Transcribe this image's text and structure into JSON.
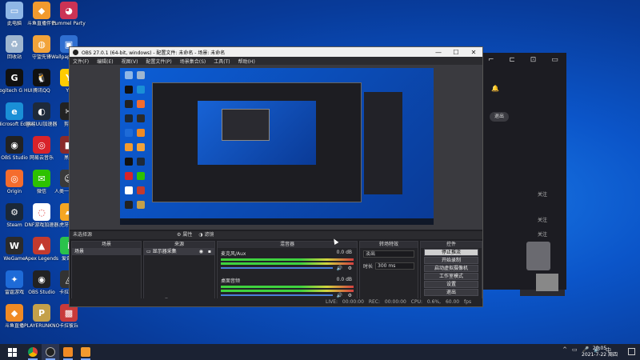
{
  "desktop_icons": [
    {
      "label": "此电脑",
      "color": "#8fb7e6",
      "glyph": "▭",
      "icon": "computer-icon"
    },
    {
      "label": "回收站",
      "color": "#9fb6cf",
      "glyph": "♻",
      "icon": "recycle-bin-icon"
    },
    {
      "label": "Logitech G HUB",
      "color": "#111111",
      "glyph": "G",
      "icon": "logitech-icon"
    },
    {
      "label": "Microsoft Edge",
      "color": "#1a8fd6",
      "glyph": "e",
      "icon": "edge-icon"
    },
    {
      "label": "OBS Studio",
      "color": "#222222",
      "glyph": "◉",
      "icon": "obs-icon"
    },
    {
      "label": "Origin",
      "color": "#f56c2d",
      "glyph": "◎",
      "icon": "origin-icon"
    },
    {
      "label": "Steam",
      "color": "#1b2838",
      "glyph": "⚙",
      "icon": "steam-icon"
    },
    {
      "label": "WeGame",
      "color": "#2b2b2b",
      "glyph": "W",
      "icon": "wegame-icon"
    },
    {
      "label": "雷霆游戏",
      "color": "#1e6bd8",
      "glyph": "✦",
      "icon": "leiting-icon"
    },
    {
      "label": "斗鱼直播",
      "color": "#f08a24",
      "glyph": "◆",
      "icon": "douyu-icon"
    },
    {
      "label": "斗鱼直播伴侣",
      "color": "#f29a2e",
      "glyph": "◆",
      "icon": "douyu-companion-icon"
    },
    {
      "label": "守望先锋",
      "color": "#f2a33a",
      "glyph": "◍",
      "icon": "overwatch-icon"
    },
    {
      "label": "腾讯QQ",
      "color": "#111111",
      "glyph": "🐧",
      "icon": "qq-icon"
    },
    {
      "label": "网易UU加速器",
      "color": "#1e2a3a",
      "glyph": "◐",
      "icon": "uu-icon"
    },
    {
      "label": "网易云音乐",
      "color": "#d8232a",
      "glyph": "◎",
      "icon": "netease-music-icon"
    },
    {
      "label": "微信",
      "color": "#2dc100",
      "glyph": "✉",
      "icon": "wechat-icon"
    },
    {
      "label": "DNF游戏加速器",
      "color": "#ffffff",
      "glyph": "◌",
      "icon": "dnf-icon"
    },
    {
      "label": "Apex Legends",
      "color": "#c33a2e",
      "glyph": "▲",
      "icon": "apex-icon"
    },
    {
      "label": "OBS Studio",
      "color": "#222222",
      "glyph": "◉",
      "icon": "obs-icon-2"
    },
    {
      "label": "PLAYERUNKNOWN BATTLEGR...",
      "color": "#c4a04a",
      "glyph": "P",
      "icon": "pubg-icon"
    },
    {
      "label": "Pummel Party",
      "color": "#cc3355",
      "glyph": "◕",
      "icon": "pummel-icon"
    },
    {
      "label": "Wallpaper Engine",
      "color": "#2f6fd0",
      "glyph": "▣",
      "icon": "wallpaper-icon"
    },
    {
      "label": "YY",
      "color": "#ffcc00",
      "glyph": "Y",
      "icon": "yy-icon"
    },
    {
      "label": "剪映",
      "color": "#222222",
      "glyph": "✂",
      "icon": "jianying-icon"
    },
    {
      "label": "黑盒",
      "color": "#8a2a2a",
      "glyph": "■",
      "icon": "blackbox-icon"
    },
    {
      "label": "人类一败涂地",
      "color": "#3a3a3a",
      "glyph": "☺",
      "icon": "human-icon"
    },
    {
      "label": "虎牙直播",
      "color": "#f5a623",
      "glyph": "▰",
      "icon": "huya-icon"
    },
    {
      "label": "爱奇艺",
      "color": "#2ac24b",
      "glyph": "i",
      "icon": "iqiyi-icon"
    },
    {
      "label": "卡拉彼丘",
      "color": "#333333",
      "glyph": "◬",
      "icon": "game-icon"
    },
    {
      "label": "卡拉彼丘",
      "color": "#c83a3a",
      "glyph": "▩",
      "icon": "game2-icon"
    }
  ],
  "obs": {
    "title": "OBS 27.0.1 (64-bit, windows) - 配置文件: 未命名 - 场景: 未命名",
    "menu": [
      "文件(F)",
      "编辑(E)",
      "视图(V)",
      "配置文件(P)",
      "场景集合(S)",
      "工具(T)",
      "帮助(H)"
    ],
    "no_source_selected": "未选择源",
    "properties_label": "属性",
    "filters_label": "滤镜",
    "docks": {
      "scenes": {
        "header": "场景",
        "items": [
          "场景"
        ]
      },
      "sources": {
        "header": "来源",
        "items": [
          "显示器采集"
        ]
      },
      "mixer": {
        "header": "混音器",
        "channels": [
          {
            "name": "麦克风/Aux",
            "db": "0.0 dB"
          },
          {
            "name": "桌面音频",
            "db": "0.0 dB"
          }
        ]
      },
      "transitions": {
        "header": "转场特效",
        "type": "淡出",
        "duration_label": "时长",
        "duration": "300 ms"
      },
      "controls": {
        "header": "控件",
        "buttons": [
          "停止推流",
          "开始录制",
          "启动虚拟摄像机",
          "工作室模式",
          "设置",
          "退出"
        ]
      }
    },
    "status": {
      "live": "LIVE: 00:00:00",
      "rec": "REC: 00:00:00",
      "cpu": "CPU: 0.6%, 60.00 fps"
    }
  },
  "right_window": {
    "button": "退出",
    "labels": [
      "关注",
      "关注",
      "关注"
    ]
  },
  "taskbar": {
    "time": "20:05",
    "date": "2021-7-22 周四",
    "tray": [
      "^",
      "▭",
      "🎤",
      "🔊",
      "中"
    ]
  }
}
